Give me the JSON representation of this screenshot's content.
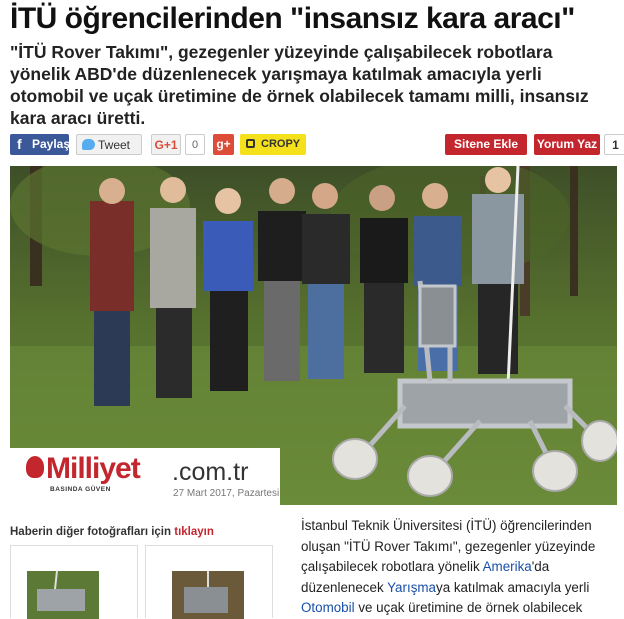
{
  "headline": "İTÜ öğrencilerinden \"insansız kara aracı\"",
  "summary": "\"İTÜ Rover Takımı\", gezegenler yüzeyinde çalışabilecek robotlara yönelik ABD'de düzenlenecek yarışmaya katılmak amacıyla yerli otomobil ve uçak üretimine de örnek olabilecek tamamı milli, insansız kara aracı üretti.",
  "share": {
    "facebook_label": "Paylaş",
    "tweet_label": "Tweet",
    "gplus_label": "G+1",
    "gplus_count": "0",
    "gplus_red_label": "g+",
    "cropy_label": "CROPY",
    "sitene_ekle_label": "Sitene Ekle",
    "yorum_yaz_label": "Yorum Yaz",
    "comment_count": "1"
  },
  "logo": {
    "name": "Milliyet",
    "domain": ".com.tr",
    "tagline": "BASINDA GÜVEN",
    "date": "27 Mart 2017, Pazartesi"
  },
  "more_photos": {
    "text": "Haberin diğer fotoğrafları için",
    "link": "tıklayın"
  },
  "article": {
    "p1": "İstanbul Teknik Üniversitesi (İTÜ) öğrencilerinden oluşan \"İTÜ Rover Takımı\", gezegenler yüzeyinde çalışabilecek robotlara yönelik ",
    "link1": "Amerika",
    "p2": "'da düzenlenecek ",
    "link2": "Yarışma",
    "p3": "ya katılmak amacıyla yerli ",
    "link3": "Otomobil",
    "p4": " ve uçak üretimine de örnek olabilecek"
  },
  "colors": {
    "brand_red": "#c4262e",
    "facebook_blue": "#3b5998",
    "link_blue": "#1a4fa8"
  }
}
